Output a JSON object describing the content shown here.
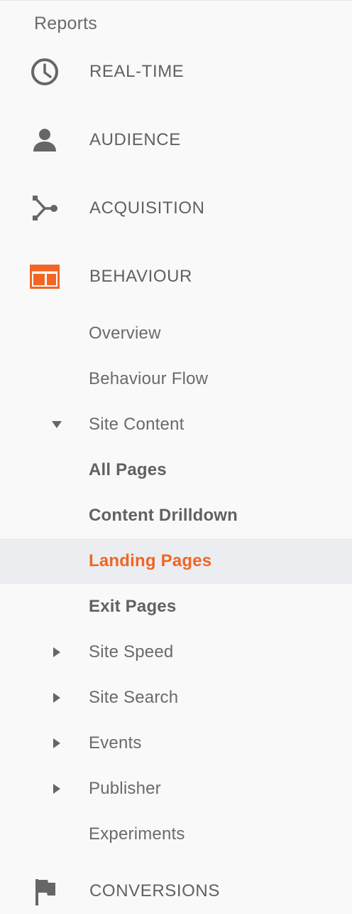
{
  "sidebar": {
    "section_label": "Reports",
    "top_items": [
      {
        "label": "REAL-TIME",
        "icon": "clock-icon"
      },
      {
        "label": "AUDIENCE",
        "icon": "person-icon"
      },
      {
        "label": "ACQUISITION",
        "icon": "acquisition-icon"
      },
      {
        "label": "BEHAVIOUR",
        "icon": "behaviour-icon"
      },
      {
        "label": "CONVERSIONS",
        "icon": "flag-icon"
      }
    ],
    "behaviour_items": [
      {
        "label": "Overview"
      },
      {
        "label": "Behaviour Flow"
      },
      {
        "label": "Site Content",
        "expander": "expanded"
      },
      {
        "label": "All Pages"
      },
      {
        "label": "Content Drilldown"
      },
      {
        "label": "Landing Pages",
        "selected": true
      },
      {
        "label": "Exit Pages"
      },
      {
        "label": "Site Speed",
        "expander": "collapsed"
      },
      {
        "label": "Site Search",
        "expander": "collapsed"
      },
      {
        "label": "Events",
        "expander": "collapsed"
      },
      {
        "label": "Publisher",
        "expander": "collapsed"
      },
      {
        "label": "Experiments"
      }
    ]
  },
  "colors": {
    "accent": "#f26522",
    "icon": "#666666",
    "text": "#616161",
    "selected_bg": "#ebedf0",
    "background": "#f9f9f9"
  }
}
